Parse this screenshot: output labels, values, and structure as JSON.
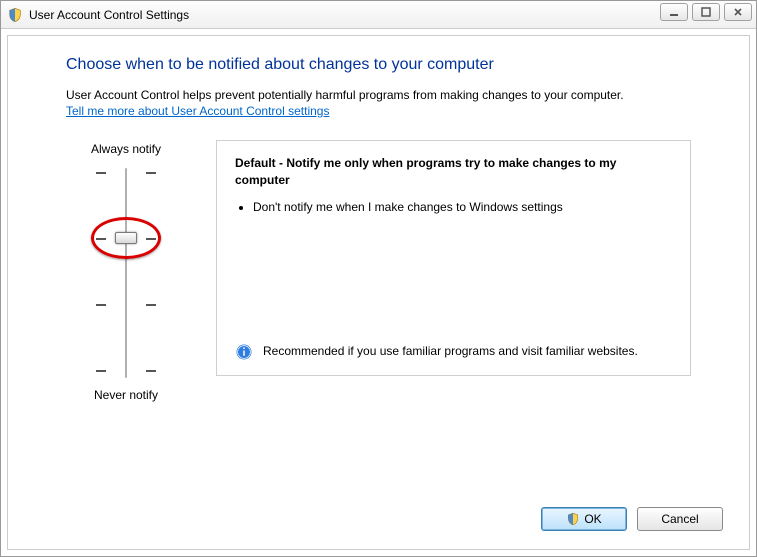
{
  "window": {
    "title": "User Account Control Settings"
  },
  "heading": "Choose when to be notified about changes to your computer",
  "intro": "User Account Control helps prevent potentially harmful programs from making changes to your computer.",
  "help_link": "Tell me more about User Account Control settings",
  "slider": {
    "top_label": "Always notify",
    "bottom_label": "Never notify",
    "levels": 4,
    "current_level_index": 1
  },
  "description": {
    "title": "Default - Notify me only when programs try to make changes to my computer",
    "bullets": [
      "Don't notify me when I make changes to Windows settings"
    ],
    "recommend": "Recommended if you use familiar programs and visit familiar websites."
  },
  "buttons": {
    "ok": "OK",
    "cancel": "Cancel"
  }
}
